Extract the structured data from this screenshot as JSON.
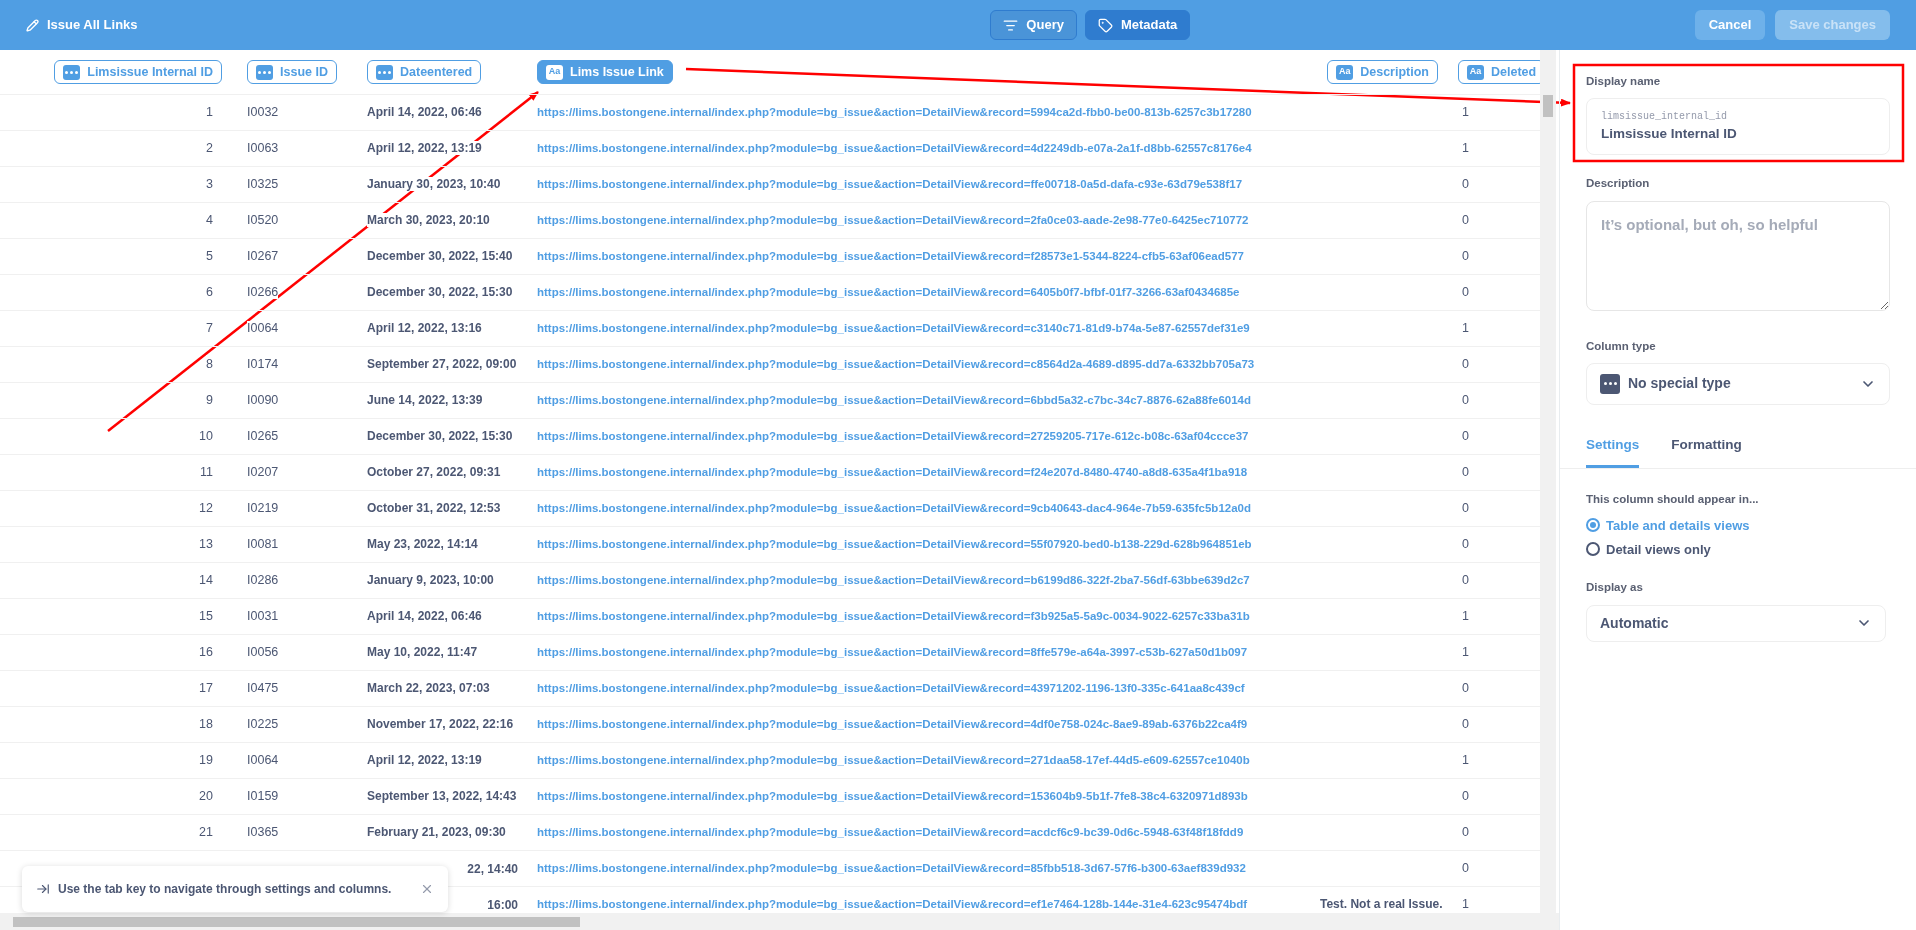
{
  "header": {
    "title": "Issue All Links",
    "modes": [
      {
        "label": "Query",
        "selected": false
      },
      {
        "label": "Metadata",
        "selected": true
      }
    ],
    "buttons": [
      {
        "label": "Cancel",
        "disabled": false
      },
      {
        "label": "Save changes",
        "disabled": true
      }
    ]
  },
  "table": {
    "columns": [
      {
        "label": "Limsissue Internal ID",
        "kind": "dots",
        "selected": false
      },
      {
        "label": "Issue ID",
        "kind": "dots",
        "selected": false
      },
      {
        "label": "Dateentered",
        "kind": "dots",
        "selected": false
      },
      {
        "label": "Lims Issue Link",
        "kind": "text",
        "icon_label": "Aa",
        "selected": true
      },
      {
        "label": "Description",
        "kind": "text",
        "icon_label": "Aa",
        "selected": false
      },
      {
        "label": "Deleted",
        "kind": "text",
        "icon_label": "Aa",
        "selected": false
      }
    ],
    "rows": [
      {
        "number": "1",
        "issue_id": "I0032",
        "date": "April 14, 2022, 06:46",
        "link": "https://lims.bostongene.internal/index.php?module=bg_issue&action=DetailView&record=5994ca2d-fbb0-be00-813b-6257c3b17280",
        "deleted": "1"
      },
      {
        "number": "2",
        "issue_id": "I0063",
        "date": "April 12, 2022, 13:19",
        "link": "https://lims.bostongene.internal/index.php?module=bg_issue&action=DetailView&record=4d2249db-e07a-2a1f-d8bb-62557c8176e4",
        "deleted": "1"
      },
      {
        "number": "3",
        "issue_id": "I0325",
        "date": "January 30, 2023, 10:40",
        "link": "https://lims.bostongene.internal/index.php?module=bg_issue&action=DetailView&record=ffe00718-0a5d-dafa-c93e-63d79e538f17",
        "deleted": "0"
      },
      {
        "number": "4",
        "issue_id": "I0520",
        "date": "March 30, 2023, 20:10",
        "link": "https://lims.bostongene.internal/index.php?module=bg_issue&action=DetailView&record=2fa0ce03-aade-2e98-77e0-6425ec710772",
        "deleted": "0"
      },
      {
        "number": "5",
        "issue_id": "I0267",
        "date": "December 30, 2022, 15:40",
        "link": "https://lims.bostongene.internal/index.php?module=bg_issue&action=DetailView&record=f28573e1-5344-8224-cfb5-63af06ead577",
        "deleted": "0"
      },
      {
        "number": "6",
        "issue_id": "I0266",
        "date": "December 30, 2022, 15:30",
        "link": "https://lims.bostongene.internal/index.php?module=bg_issue&action=DetailView&record=6405b0f7-bfbf-01f7-3266-63af0434685e",
        "deleted": "0"
      },
      {
        "number": "7",
        "issue_id": "I0064",
        "date": "April 12, 2022, 13:16",
        "link": "https://lims.bostongene.internal/index.php?module=bg_issue&action=DetailView&record=c3140c71-81d9-b74a-5e87-62557def31e9",
        "deleted": "1"
      },
      {
        "number": "8",
        "issue_id": "I0174",
        "date": "September 27, 2022, 09:00",
        "link": "https://lims.bostongene.internal/index.php?module=bg_issue&action=DetailView&record=c8564d2a-4689-d895-dd7a-6332bb705a73",
        "deleted": "0"
      },
      {
        "number": "9",
        "issue_id": "I0090",
        "date": "June 14, 2022, 13:39",
        "link": "https://lims.bostongene.internal/index.php?module=bg_issue&action=DetailView&record=6bbd5a32-c7bc-34c7-8876-62a88fe6014d",
        "deleted": "0"
      },
      {
        "number": "10",
        "issue_id": "I0265",
        "date": "December 30, 2022, 15:30",
        "link": "https://lims.bostongene.internal/index.php?module=bg_issue&action=DetailView&record=27259205-717e-612c-b08c-63af04ccce37",
        "deleted": "0"
      },
      {
        "number": "11",
        "issue_id": "I0207",
        "date": "October 27, 2022, 09:31",
        "link": "https://lims.bostongene.internal/index.php?module=bg_issue&action=DetailView&record=f24e207d-8480-4740-a8d8-635a4f1ba918",
        "deleted": "0"
      },
      {
        "number": "12",
        "issue_id": "I0219",
        "date": "October 31, 2022, 12:53",
        "link": "https://lims.bostongene.internal/index.php?module=bg_issue&action=DetailView&record=9cb40643-dac4-964e-7b59-635fc5b12a0d",
        "deleted": "0"
      },
      {
        "number": "13",
        "issue_id": "I0081",
        "date": "May 23, 2022, 14:14",
        "link": "https://lims.bostongene.internal/index.php?module=bg_issue&action=DetailView&record=55f07920-bed0-b138-229d-628b964851eb",
        "deleted": "0"
      },
      {
        "number": "14",
        "issue_id": "I0286",
        "date": "January 9, 2023, 10:00",
        "link": "https://lims.bostongene.internal/index.php?module=bg_issue&action=DetailView&record=b6199d86-322f-2ba7-56df-63bbe639d2c7",
        "deleted": "0"
      },
      {
        "number": "15",
        "issue_id": "I0031",
        "date": "April 14, 2022, 06:46",
        "link": "https://lims.bostongene.internal/index.php?module=bg_issue&action=DetailView&record=f3b925a5-5a9c-0034-9022-6257c33ba31b",
        "deleted": "1"
      },
      {
        "number": "16",
        "issue_id": "I0056",
        "date": "May 10, 2022, 11:47",
        "link": "https://lims.bostongene.internal/index.php?module=bg_issue&action=DetailView&record=8ffe579e-a64a-3997-c53b-627a50d1b097",
        "deleted": "1"
      },
      {
        "number": "17",
        "issue_id": "I0475",
        "date": "March 22, 2023, 07:03",
        "link": "https://lims.bostongene.internal/index.php?module=bg_issue&action=DetailView&record=43971202-1196-13f0-335c-641aa8c439cf",
        "deleted": "0"
      },
      {
        "number": "18",
        "issue_id": "I0225",
        "date": "November 17, 2022, 22:16",
        "link": "https://lims.bostongene.internal/index.php?module=bg_issue&action=DetailView&record=4df0e758-024c-8ae9-89ab-6376b22ca4f9",
        "deleted": "0"
      },
      {
        "number": "19",
        "issue_id": "I0064",
        "date": "April 12, 2022, 13:19",
        "link": "https://lims.bostongene.internal/index.php?module=bg_issue&action=DetailView&record=271daa58-17ef-44d5-e609-62557ce1040b",
        "deleted": "1"
      },
      {
        "number": "20",
        "issue_id": "I0159",
        "date": "September 13, 2022, 14:43",
        "link": "https://lims.bostongene.internal/index.php?module=bg_issue&action=DetailView&record=153604b9-5b1f-7fe8-38c4-6320971d893b",
        "deleted": "0"
      },
      {
        "number": "21",
        "issue_id": "I0365",
        "date": "February 21, 2023, 09:30",
        "link": "https://lims.bostongene.internal/index.php?module=bg_issue&action=DetailView&record=acdcf6c9-bc39-0d6c-5948-63f48f18fdd9",
        "deleted": "0"
      },
      {
        "date": "22, 14:40",
        "link": "https://lims.bostongene.internal/index.php?module=bg_issue&action=DetailView&record=85fbb518-3d67-57f6-b300-63aef839d932",
        "deleted": "0"
      },
      {
        "date": "16:00",
        "link": "https://lims.bostongene.internal/index.php?module=bg_issue&action=DetailView&record=ef1e7464-128b-144e-31e4-623c95474bdf",
        "description": "Test. Not a real Issue.",
        "deleted": "1"
      }
    ]
  },
  "panel": {
    "display_name": {
      "label": "Display name",
      "field_name": "limsissue_internal_id",
      "value": "Limsissue Internal ID"
    },
    "description": {
      "label": "Description",
      "placeholder": "It’s optional, but oh, so helpful"
    },
    "column_type": {
      "label": "Column type",
      "value": "No special type"
    },
    "tabs": [
      {
        "label": "Settings",
        "selected": true
      },
      {
        "label": "Formatting",
        "selected": false
      }
    ],
    "appear_in": {
      "label": "This column should appear in...",
      "options": [
        {
          "label": "Table and details views",
          "selected": true
        },
        {
          "label": "Detail views only",
          "selected": false
        }
      ]
    },
    "display_as": {
      "label": "Display as",
      "value": "Automatic"
    }
  },
  "toast": {
    "message": "Use the tab key to navigate through settings and columns."
  }
}
